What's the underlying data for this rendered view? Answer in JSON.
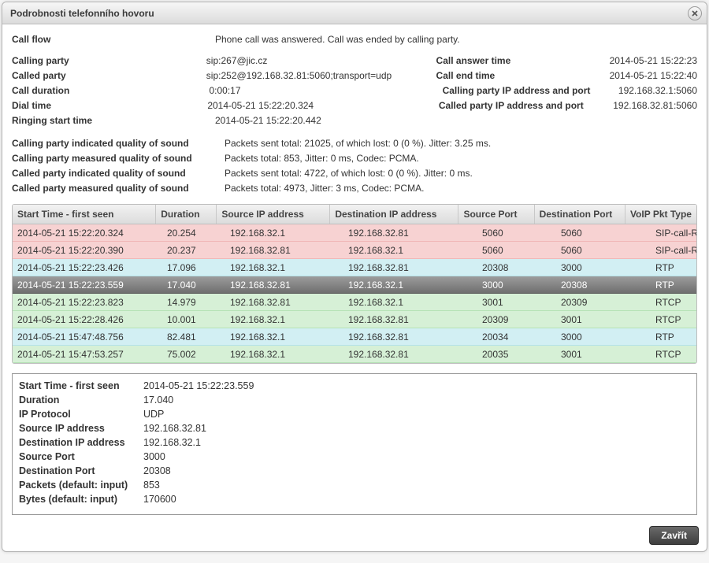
{
  "window": {
    "title": "Podrobnosti telefonního hovoru",
    "close_button_label": "Zavřít"
  },
  "callflow": {
    "label": "Call flow",
    "value": "Phone call was answered. Call was ended by calling party."
  },
  "top_left": [
    {
      "label": "Calling party",
      "value": "sip:267@jic.cz"
    },
    {
      "label": "Called party",
      "value": "sip:252@192.168.32.81:5060;transport=udp"
    },
    {
      "label": "Call duration",
      "value": "0:00:17"
    },
    {
      "label": "Dial time",
      "value": "2014-05-21 15:22:20.324"
    },
    {
      "label": "Ringing start time",
      "value": "2014-05-21 15:22:20.442"
    }
  ],
  "top_right": [
    {
      "label": "Call answer time",
      "value": "2014-05-21 15:22:23"
    },
    {
      "label": "Call end time",
      "value": "2014-05-21 15:22:40"
    },
    {
      "label": "Calling party IP address and port",
      "value": "192.168.32.1:5060"
    },
    {
      "label": "Called party IP address and port",
      "value": "192.168.32.81:5060"
    }
  ],
  "quality": [
    {
      "label": "Calling party indicated quality of sound",
      "value": "Packets sent total: 21025, of which lost: 0 (0 %). Jitter: 3.25 ms."
    },
    {
      "label": "Calling party measured quality of sound",
      "value": "Packets total: 853, Jitter: 0 ms, Codec: PCMA."
    },
    {
      "label": "Called party indicated quality of sound",
      "value": "Packets sent total: 4722, of which lost: 0 (0 %). Jitter: 0 ms."
    },
    {
      "label": "Called party measured quality of sound",
      "value": "Packets total: 4973, Jitter: 3 ms, Codec: PCMA."
    }
  ],
  "grid": {
    "headers": {
      "start": "Start Time - first seen",
      "duration": "Duration",
      "src_ip": "Source IP address",
      "dst_ip": "Destination IP address",
      "src_port": "Source Port",
      "dst_port": "Destination Port",
      "pkt_type": "VoIP Pkt Type"
    },
    "rows": [
      {
        "start": "2014-05-21 15:22:20.324",
        "dur": "20.254",
        "sip": "192.168.32.1",
        "dip": "192.168.32.81",
        "sp": "5060",
        "dp": "5060",
        "pt": "SIP-call-REQ",
        "cls": "row-pink"
      },
      {
        "start": "2014-05-21 15:22:20.390",
        "dur": "20.237",
        "sip": "192.168.32.81",
        "dip": "192.168.32.1",
        "sp": "5060",
        "dp": "5060",
        "pt": "SIP-call-RES",
        "cls": "row-pink"
      },
      {
        "start": "2014-05-21 15:22:23.426",
        "dur": "17.096",
        "sip": "192.168.32.1",
        "dip": "192.168.32.81",
        "sp": "20308",
        "dp": "3000",
        "pt": "RTP",
        "cls": "row-cyan"
      },
      {
        "start": "2014-05-21 15:22:23.559",
        "dur": "17.040",
        "sip": "192.168.32.81",
        "dip": "192.168.32.1",
        "sp": "3000",
        "dp": "20308",
        "pt": "RTP",
        "cls": "row-sel"
      },
      {
        "start": "2014-05-21 15:22:23.823",
        "dur": "14.979",
        "sip": "192.168.32.81",
        "dip": "192.168.32.1",
        "sp": "3001",
        "dp": "20309",
        "pt": "RTCP",
        "cls": "row-green"
      },
      {
        "start": "2014-05-21 15:22:28.426",
        "dur": "10.001",
        "sip": "192.168.32.1",
        "dip": "192.168.32.81",
        "sp": "20309",
        "dp": "3001",
        "pt": "RTCP",
        "cls": "row-green"
      },
      {
        "start": "2014-05-21 15:47:48.756",
        "dur": "82.481",
        "sip": "192.168.32.1",
        "dip": "192.168.32.81",
        "sp": "20034",
        "dp": "3000",
        "pt": "RTP",
        "cls": "row-cyan"
      },
      {
        "start": "2014-05-21 15:47:53.257",
        "dur": "75.002",
        "sip": "192.168.32.1",
        "dip": "192.168.32.81",
        "sp": "20035",
        "dp": "3001",
        "pt": "RTCP",
        "cls": "row-green"
      }
    ]
  },
  "detail": [
    {
      "label": "Start Time - first seen",
      "value": "2014-05-21 15:22:23.559"
    },
    {
      "label": "Duration",
      "value": "17.040"
    },
    {
      "label": "IP Protocol",
      "value": "UDP"
    },
    {
      "label": "Source IP address",
      "value": "192.168.32.81"
    },
    {
      "label": "Destination IP address",
      "value": "192.168.32.1"
    },
    {
      "label": "Source Port",
      "value": "3000"
    },
    {
      "label": "Destination Port",
      "value": "20308"
    },
    {
      "label": "Packets (default: input)",
      "value": "853"
    },
    {
      "label": "Bytes (default: input)",
      "value": "170600"
    }
  ]
}
